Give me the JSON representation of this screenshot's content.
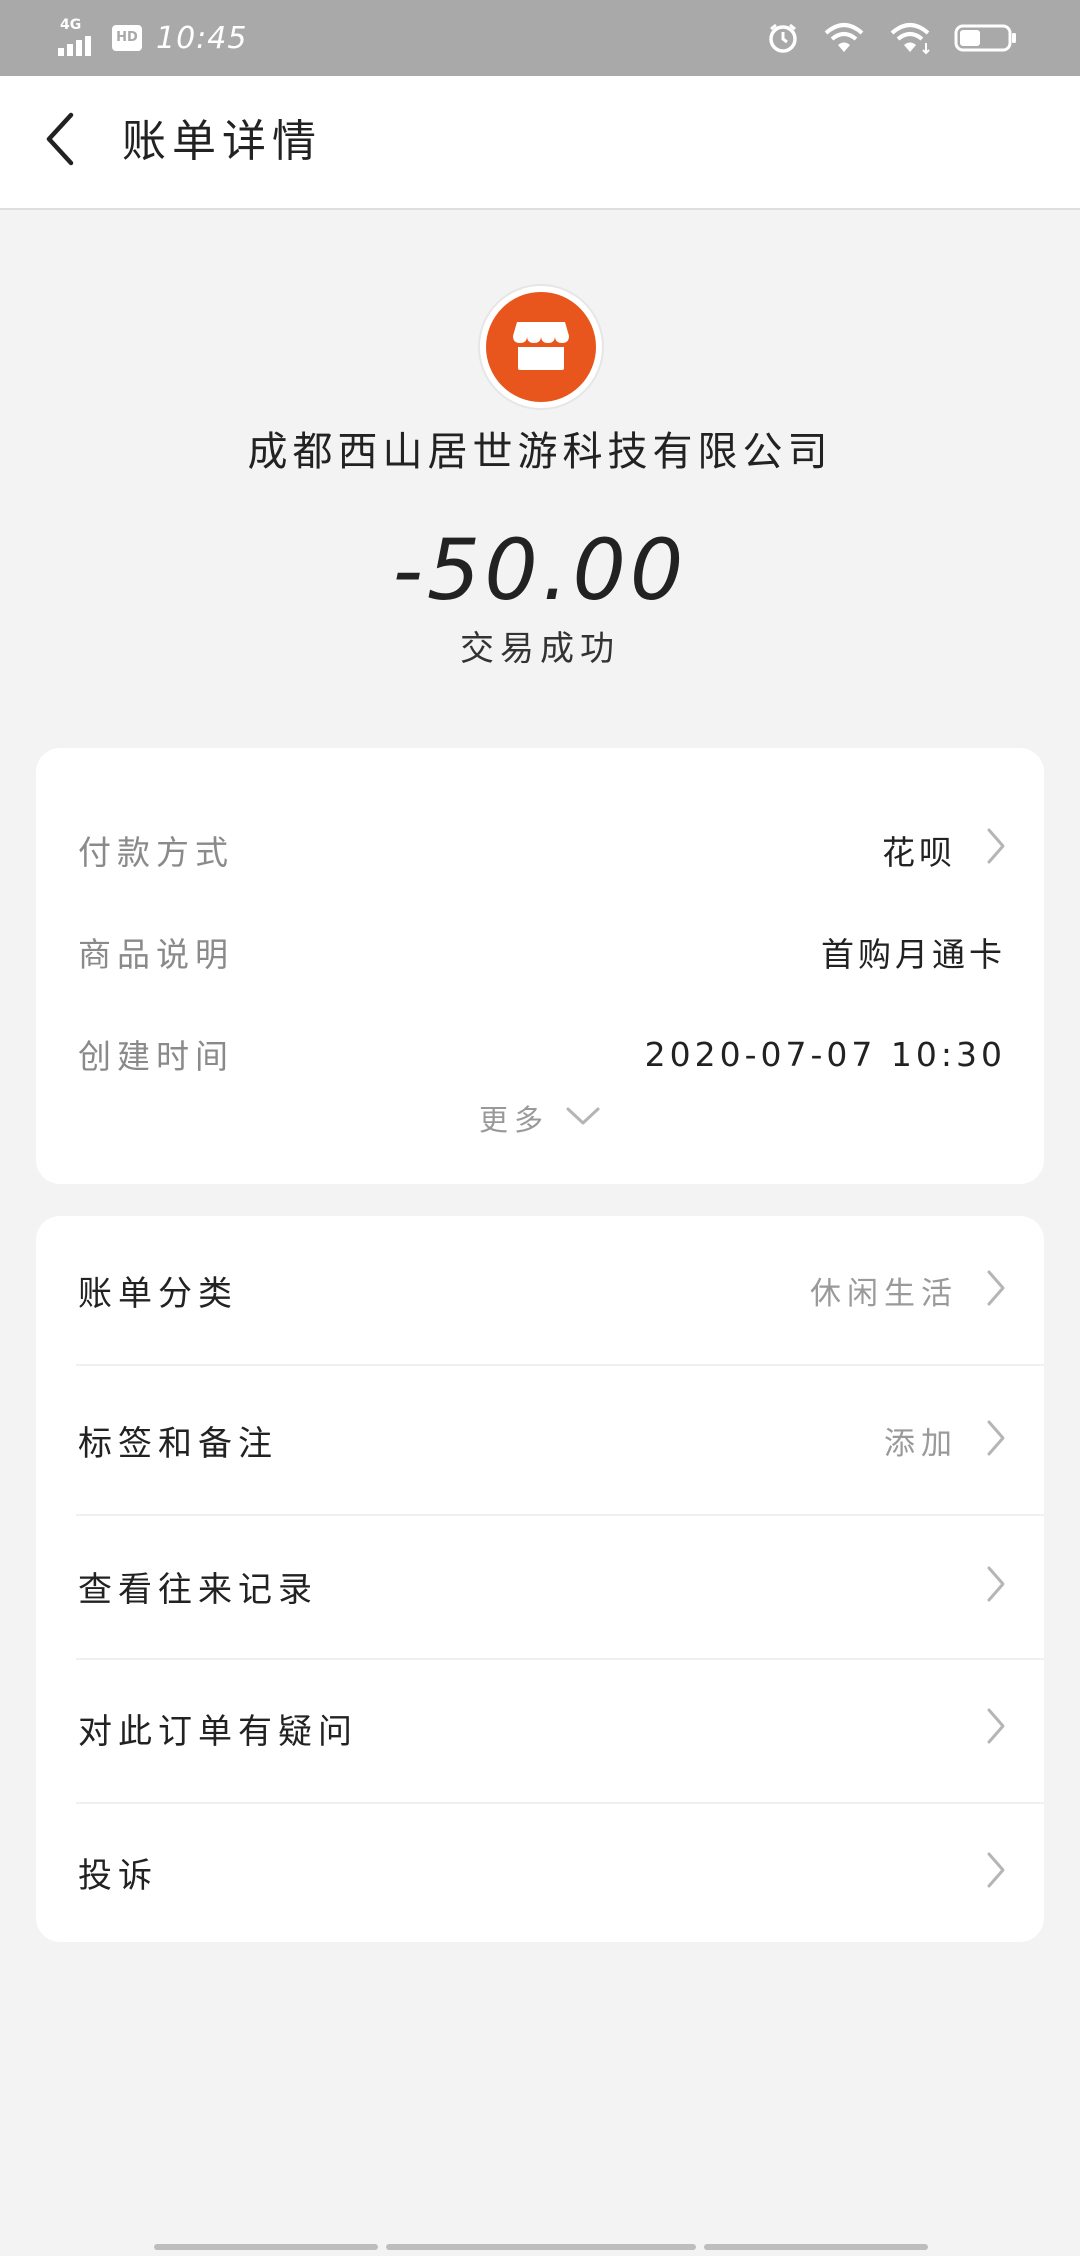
{
  "status_bar": {
    "network": "4G",
    "hd": "HD",
    "time": "10:45",
    "icons": [
      "alarm-icon",
      "wifi-call-icon",
      "wifi-icon",
      "battery-icon"
    ]
  },
  "header": {
    "back_icon": "chevron-left-icon",
    "title": "账单详情"
  },
  "merchant": {
    "icon": "store-icon",
    "accent_color": "#e8561d",
    "name": "成都西山居世游科技有限公司",
    "amount": "-50.00",
    "status": "交易成功"
  },
  "details": {
    "rows": [
      {
        "label": "付款方式",
        "value": "花呗"
      },
      {
        "label": "商品说明",
        "value": "首购月通卡"
      },
      {
        "label": "创建时间",
        "value": "2020-07-07 10:30"
      }
    ],
    "more_label": "更多"
  },
  "actions": {
    "rows": [
      {
        "label": "账单分类",
        "value": "休闲生活"
      },
      {
        "label": "标签和备注",
        "value": "添加"
      },
      {
        "label": "查看往来记录",
        "value": ""
      },
      {
        "label": "对此订单有疑问",
        "value": ""
      },
      {
        "label": "投诉",
        "value": ""
      }
    ]
  }
}
